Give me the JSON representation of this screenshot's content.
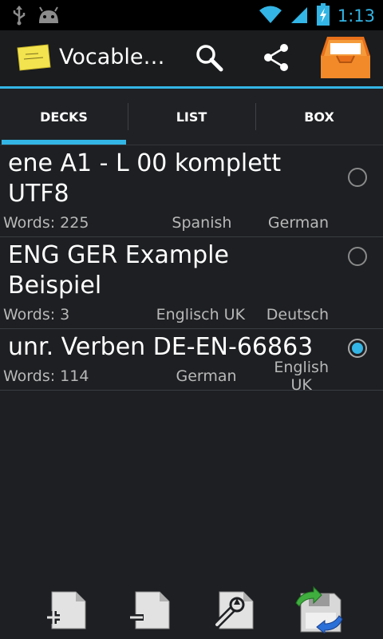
{
  "statusbar": {
    "time": "1:13",
    "icons": [
      "usb-icon",
      "android-debug-icon",
      "wifi-icon",
      "signal-icon",
      "battery-charging-icon"
    ]
  },
  "actionbar": {
    "title": "Vocable…",
    "app_icon": "sticky-note-icon",
    "buttons": [
      "search-icon",
      "share-icon",
      "inbox-box-icon"
    ]
  },
  "tabs": [
    {
      "label": "DECKS",
      "active": true
    },
    {
      "label": "LIST",
      "active": false
    },
    {
      "label": "BOX",
      "active": false
    }
  ],
  "decks": [
    {
      "title": "ene A1 - L 00 komplett UTF8",
      "words": "Words: 225",
      "source": "Spanish",
      "target": "German",
      "selected": false
    },
    {
      "title": "ENG GER Example Beispiel",
      "words": "Words: 3",
      "source": "Englisch UK",
      "target": "Deutsch",
      "selected": false
    },
    {
      "title": "unr. Verben DE-EN-66863",
      "words": "Words: 114",
      "source": "German",
      "target": "English UK",
      "selected": true
    }
  ],
  "bottombar": {
    "buttons": [
      "add-deck-icon",
      "remove-deck-icon",
      "edit-deck-icon",
      "save-sync-icon"
    ]
  },
  "colors": {
    "accent": "#33b5e5",
    "background": "#1d1f22"
  }
}
